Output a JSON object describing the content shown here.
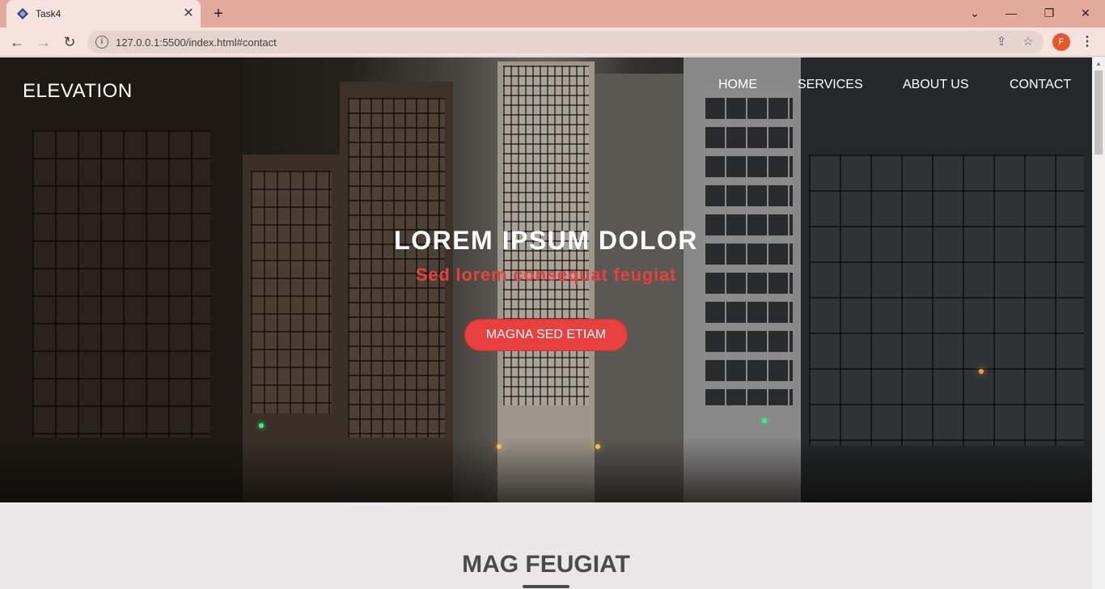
{
  "browser": {
    "tab_title": "Task4",
    "tab_close": "✕",
    "new_tab": "+",
    "url": "127.0.0.1:5500/index.html#contact",
    "profile_initial": "F",
    "window_controls": {
      "dropdown": "⌄",
      "minimize": "—",
      "restore": "❐",
      "close": "✕"
    },
    "nav": {
      "back": "←",
      "forward": "→",
      "reload": "↻"
    },
    "icons": [
      "info-icon",
      "share-icon",
      "star-icon",
      "menu-dots-icon"
    ]
  },
  "header": {
    "logo": "ELEVATION",
    "nav_items": [
      "HOME",
      "SERVICES",
      "ABOUT US",
      "CONTACT"
    ]
  },
  "hero": {
    "title": "LOREM IPSUM DOLOR",
    "subtitle": "Sed lorem consequat feugiat",
    "button_label": "MAGNA SED ETIAM"
  },
  "section": {
    "title": "MAG FEUGIAT"
  },
  "colors": {
    "accent": "#e8403f",
    "tab_bar": "#e3a99a",
    "toolbar": "#f7e3de",
    "section_bg": "#e9e7e8",
    "profile": "#e8552a"
  }
}
